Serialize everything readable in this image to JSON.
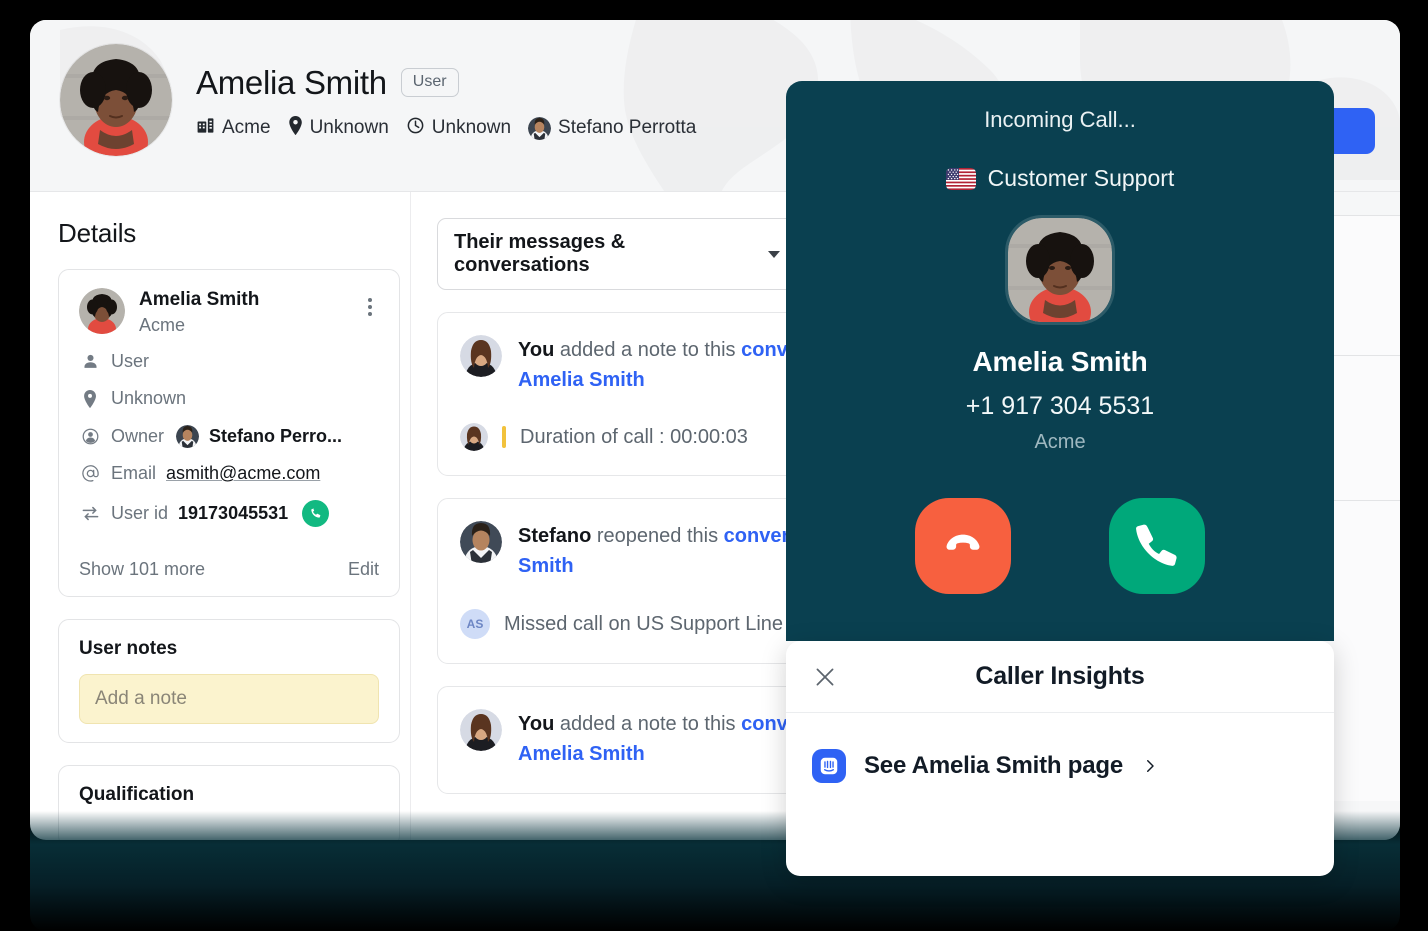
{
  "header": {
    "name": "Amelia Smith",
    "role_badge": "User",
    "meta": [
      {
        "icon": "building-icon",
        "label": "Acme"
      },
      {
        "icon": "location-pin-icon",
        "label": "Unknown"
      },
      {
        "icon": "clock-icon",
        "label": "Unknown"
      },
      {
        "icon": "owner-avatar",
        "label": "Stefano Perrotta"
      }
    ]
  },
  "details": {
    "title": "Details",
    "person": {
      "name": "Amelia Smith",
      "company": "Acme"
    },
    "attributes": [
      {
        "icon": "person-icon",
        "label": "User",
        "value": ""
      },
      {
        "icon": "location-pin-icon",
        "label": "Unknown",
        "value": ""
      },
      {
        "icon": "globe-person-icon",
        "label": "Owner",
        "value": "Stefano Perro..."
      },
      {
        "icon": "at-sign-icon",
        "label": "Email",
        "value": "asmith@acme.com"
      },
      {
        "icon": "exchange-icon",
        "label": "User id",
        "value": "19173045531"
      }
    ],
    "show_more": "Show 101 more",
    "edit": "Edit"
  },
  "user_notes": {
    "title": "User notes",
    "placeholder": "Add a note",
    "value": ""
  },
  "qualification": {
    "title": "Qualification"
  },
  "feed": {
    "filter_label": "Their messages & conversations",
    "items": [
      {
        "actor": "You",
        "action": " added a note to this ",
        "link": "conv",
        "link2": "Amelia Smith",
        "sub_text": "Duration of call : 00:00:03",
        "sub_avatar": "agent-avatar"
      },
      {
        "actor": "Stefano",
        "action": " reopened this ",
        "link": "conver",
        "link2": "Smith",
        "sub_text": "Missed call on US Support Line",
        "sub_avatar": "AS"
      },
      {
        "actor": "You",
        "action": " added a note to this ",
        "link": "conv",
        "link2": "Amelia Smith",
        "sub_text": "",
        "sub_avatar": ""
      }
    ]
  },
  "call_overlay": {
    "status": "Incoming Call...",
    "line_name": "Customer Support",
    "flag": "us-flag-icon",
    "caller_name": "Amelia Smith",
    "caller_phone": "+1 917 304 5531",
    "caller_org": "Acme",
    "decline_label": "decline-call",
    "accept_label": "accept-call",
    "decline_color": "#f7603f",
    "accept_color": "#00a87a"
  },
  "insights": {
    "title": "Caller Insights",
    "close": "close-icon",
    "link_text": "See Amelia Smith page",
    "app_icon": "intercom-icon",
    "accent": "#2f62f4"
  },
  "header_action": {
    "label": ""
  }
}
